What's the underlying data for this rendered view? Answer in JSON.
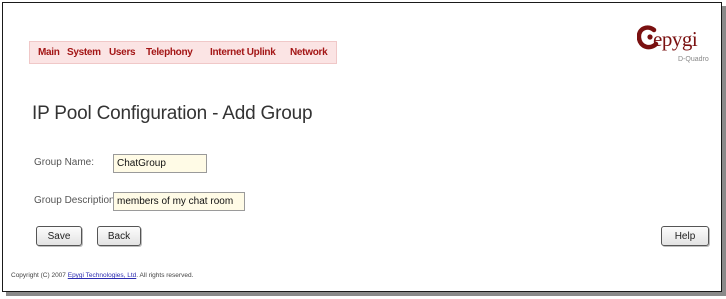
{
  "nav": {
    "items": [
      {
        "label": "Main"
      },
      {
        "label": "System"
      },
      {
        "label": "Users"
      },
      {
        "label": "Telephony"
      },
      {
        "label": "Internet Uplink"
      },
      {
        "label": "Network"
      }
    ]
  },
  "logo": {
    "text": "epygi",
    "subtitle": "D-Quadro"
  },
  "page": {
    "title": "IP Pool Configuration - Add Group"
  },
  "form": {
    "group_name": {
      "label": "Group Name:",
      "value": "ChatGroup"
    },
    "group_description": {
      "label": "Group Description:",
      "value": "members of my chat room"
    }
  },
  "buttons": {
    "save": "Save",
    "back": "Back",
    "help": "Help"
  },
  "footer": {
    "prefix": "Copyright (C) 2007 ",
    "link": "Epygi Technologies, Ltd",
    "suffix": ". All rights reserved."
  },
  "colors": {
    "nav_background": "#fbe4e4",
    "nav_text": "#a31616",
    "logo": "#7a1010",
    "input_background": "#fffbe6"
  }
}
